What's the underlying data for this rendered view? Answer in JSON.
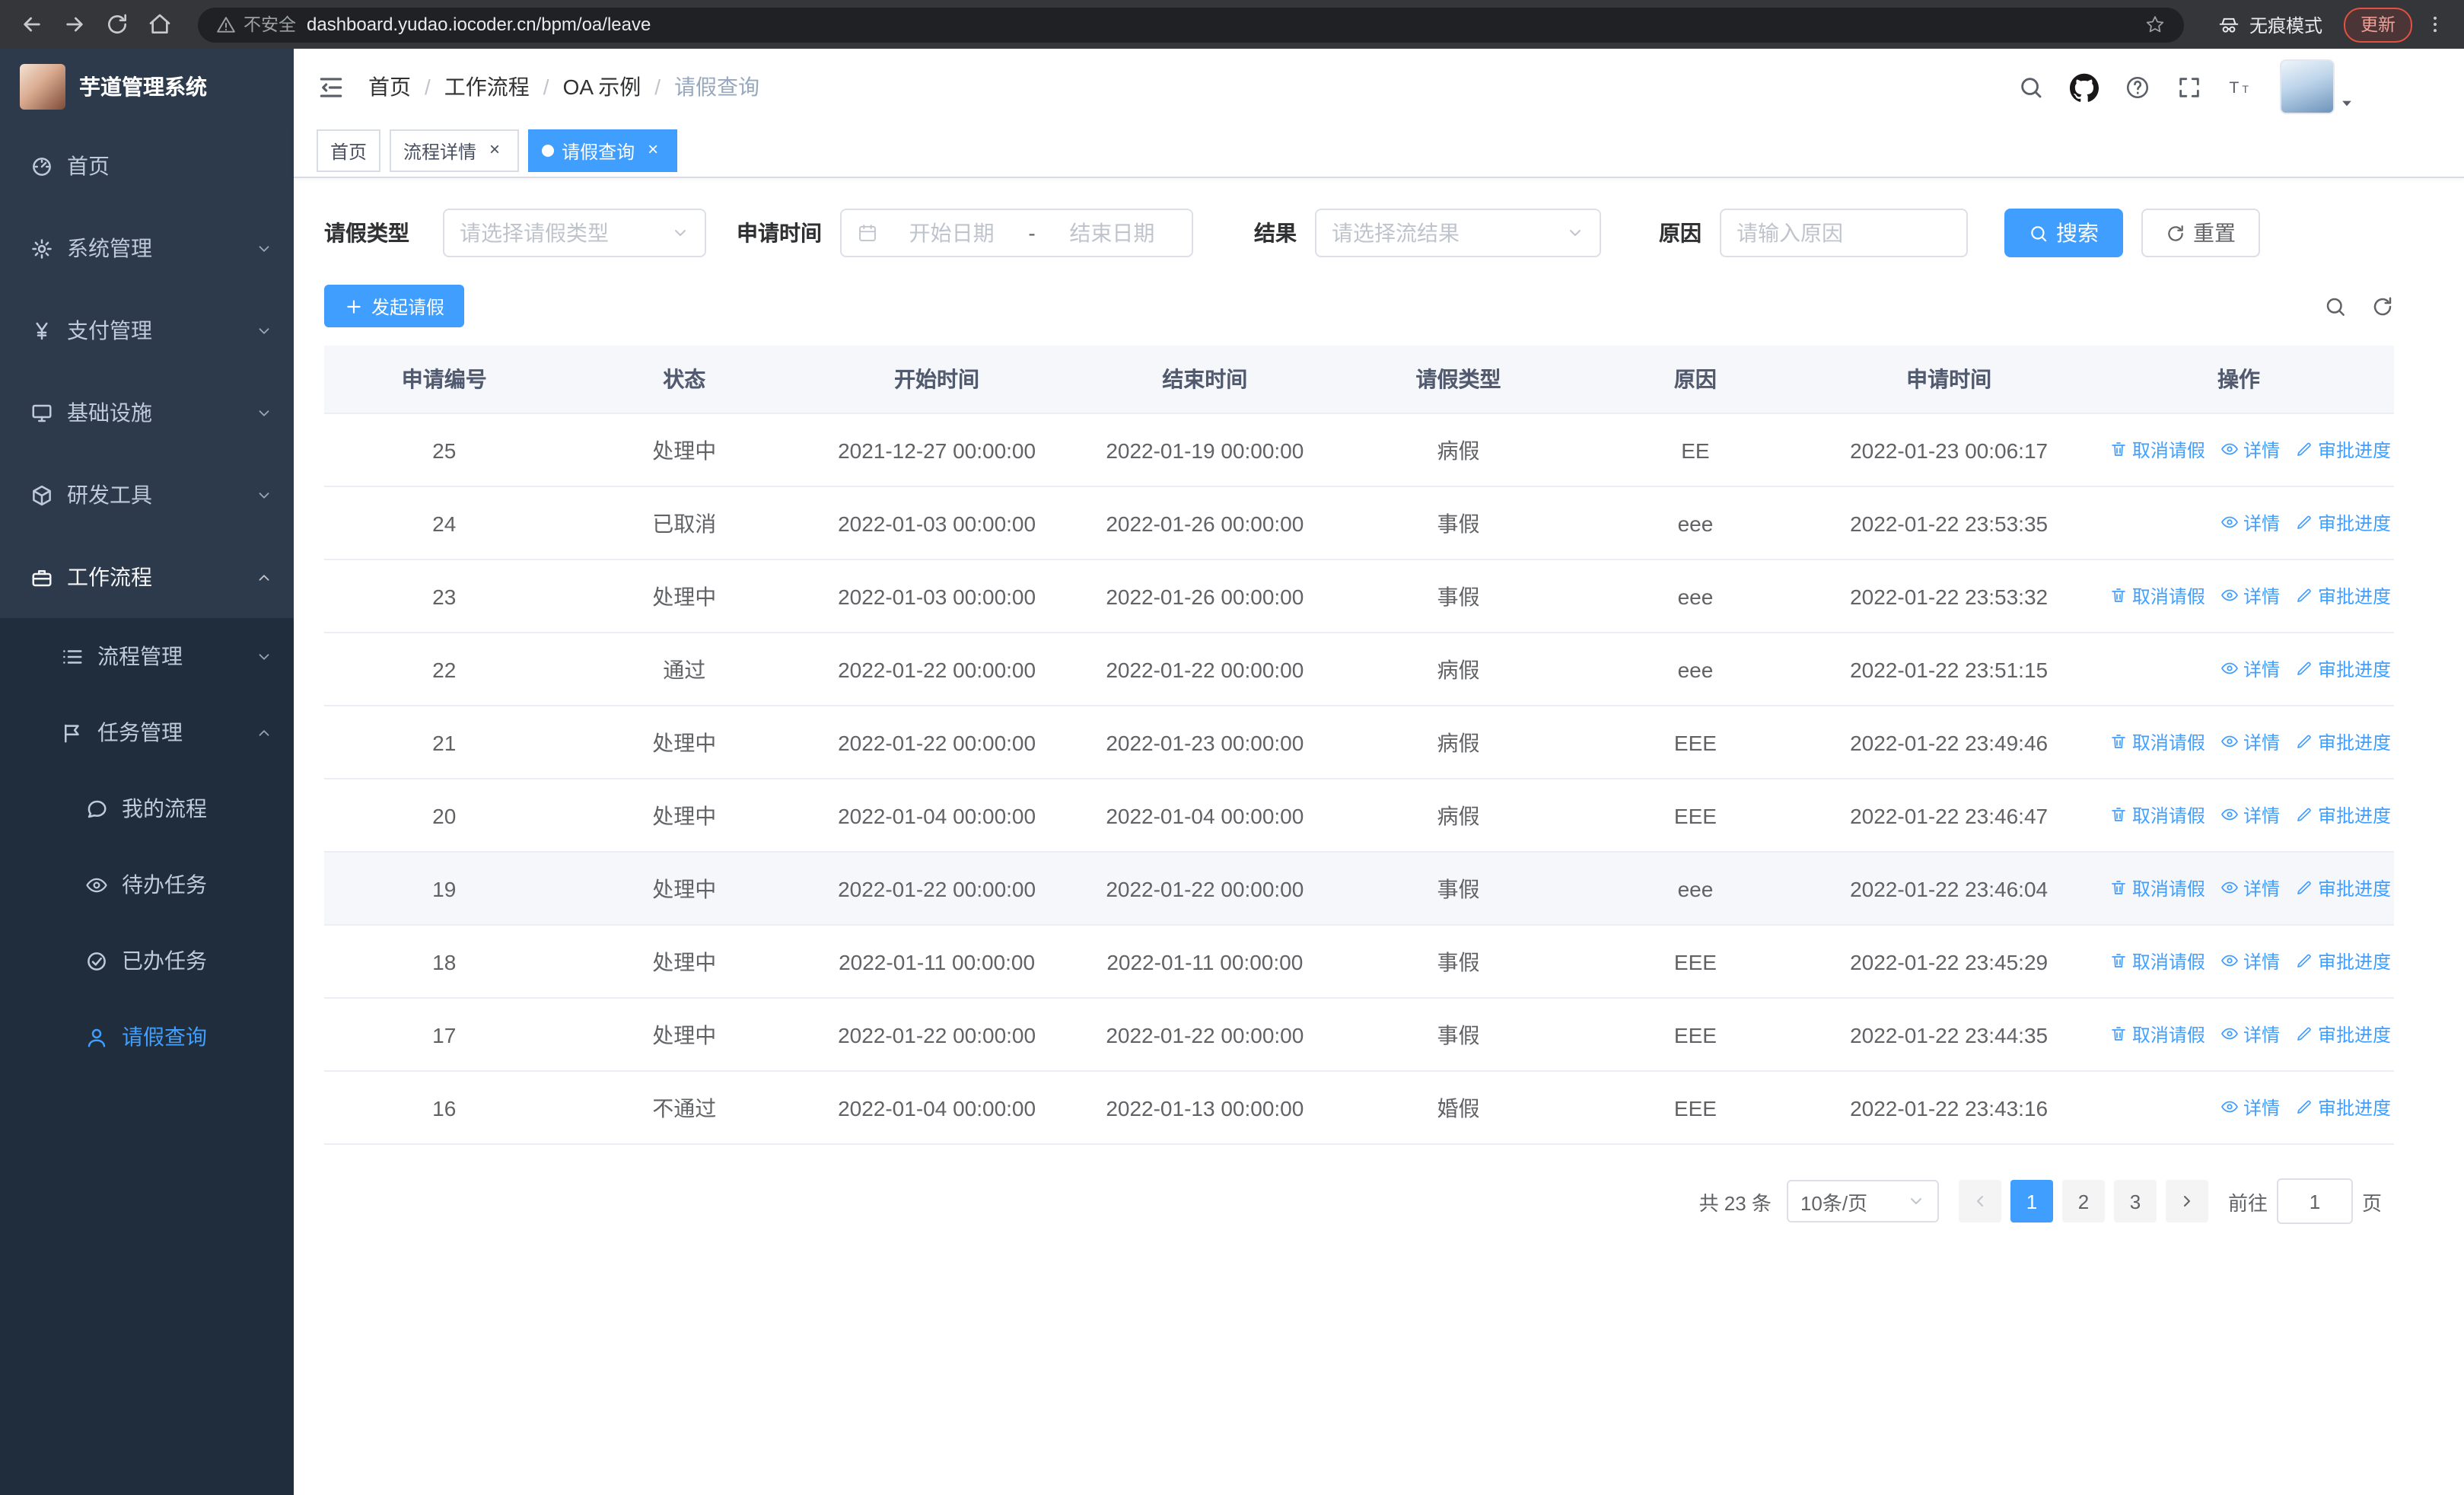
{
  "browser": {
    "security_chip": "不安全",
    "url": "dashboard.yudao.iocoder.cn/bpm/oa/leave",
    "incognito_label": "无痕模式",
    "update_label": "更新"
  },
  "sidebar": {
    "logo_title": "芋道管理系统",
    "items": [
      {
        "name": "home",
        "label": "首页",
        "icon": "dashboard-icon",
        "level": 1
      },
      {
        "name": "system",
        "label": "系统管理",
        "icon": "gear-icon",
        "level": 1,
        "arrow": "down"
      },
      {
        "name": "payment",
        "label": "支付管理",
        "icon": "yen-icon",
        "level": 1,
        "arrow": "down"
      },
      {
        "name": "infrastructure",
        "label": "基础设施",
        "icon": "infra-icon",
        "level": 1,
        "arrow": "down"
      },
      {
        "name": "devtools",
        "label": "研发工具",
        "icon": "tools-icon",
        "level": 1,
        "arrow": "down"
      },
      {
        "name": "workflow",
        "label": "工作流程",
        "icon": "workflow-icon",
        "level": 1,
        "arrow": "up",
        "expanded": true
      },
      {
        "name": "process-management",
        "label": "流程管理",
        "icon": "process-icon",
        "level": 2,
        "arrow": "down"
      },
      {
        "name": "task-management",
        "label": "任务管理",
        "icon": "task-icon",
        "level": 2,
        "arrow": "up",
        "expanded": true
      },
      {
        "name": "my-process",
        "label": "我的流程",
        "icon": "chat-icon",
        "level": 3
      },
      {
        "name": "todo-tasks",
        "label": "待办任务",
        "icon": "eye-icon",
        "level": 3
      },
      {
        "name": "done-tasks",
        "label": "已办任务",
        "icon": "check-circle-icon",
        "level": 3
      },
      {
        "name": "leave-query",
        "label": "请假查询",
        "icon": "user-icon",
        "level": 3,
        "active": true
      }
    ]
  },
  "header": {
    "breadcrumb": [
      "首页",
      "工作流程",
      "OA 示例",
      "请假查询"
    ]
  },
  "tabs": [
    {
      "name": "home",
      "label": "首页",
      "closable": false,
      "active": false
    },
    {
      "name": "process-detail",
      "label": "流程详情",
      "closable": true,
      "active": false
    },
    {
      "name": "leave-query",
      "label": "请假查询",
      "closable": true,
      "active": true
    }
  ],
  "filters": {
    "type_label": "请假类型",
    "type_placeholder": "请选择请假类型",
    "time_label": "申请时间",
    "start_placeholder": "开始日期",
    "range_separator": "-",
    "end_placeholder": "结束日期",
    "result_label": "结果",
    "result_placeholder": "请选择流结果",
    "reason_label": "原因",
    "reason_placeholder": "请输入原因",
    "search_label": "搜索",
    "reset_label": "重置"
  },
  "toolbar": {
    "create_label": "发起请假"
  },
  "table": {
    "columns": [
      "申请编号",
      "状态",
      "开始时间",
      "结束时间",
      "请假类型",
      "原因",
      "申请时间",
      "操作"
    ],
    "actions": {
      "cancel": "取消请假",
      "detail": "详情",
      "progress": "审批进度"
    },
    "rows": [
      {
        "id": "25",
        "status": "处理中",
        "start": "2021-12-27 00:00:00",
        "end": "2022-01-19 00:00:00",
        "type": "病假",
        "reason": "EE",
        "applied": "2022-01-23 00:06:17",
        "cancelable": true
      },
      {
        "id": "24",
        "status": "已取消",
        "start": "2022-01-03 00:00:00",
        "end": "2022-01-26 00:00:00",
        "type": "事假",
        "reason": "eee",
        "applied": "2022-01-22 23:53:35",
        "cancelable": false
      },
      {
        "id": "23",
        "status": "处理中",
        "start": "2022-01-03 00:00:00",
        "end": "2022-01-26 00:00:00",
        "type": "事假",
        "reason": "eee",
        "applied": "2022-01-22 23:53:32",
        "cancelable": true
      },
      {
        "id": "22",
        "status": "通过",
        "start": "2022-01-22 00:00:00",
        "end": "2022-01-22 00:00:00",
        "type": "病假",
        "reason": "eee",
        "applied": "2022-01-22 23:51:15",
        "cancelable": false
      },
      {
        "id": "21",
        "status": "处理中",
        "start": "2022-01-22 00:00:00",
        "end": "2022-01-23 00:00:00",
        "type": "病假",
        "reason": "EEE",
        "applied": "2022-01-22 23:49:46",
        "cancelable": true
      },
      {
        "id": "20",
        "status": "处理中",
        "start": "2022-01-04 00:00:00",
        "end": "2022-01-04 00:00:00",
        "type": "病假",
        "reason": "EEE",
        "applied": "2022-01-22 23:46:47",
        "cancelable": true
      },
      {
        "id": "19",
        "status": "处理中",
        "start": "2022-01-22 00:00:00",
        "end": "2022-01-22 00:00:00",
        "type": "事假",
        "reason": "eee",
        "applied": "2022-01-22 23:46:04",
        "cancelable": true,
        "highlighted": true
      },
      {
        "id": "18",
        "status": "处理中",
        "start": "2022-01-11 00:00:00",
        "end": "2022-01-11 00:00:00",
        "type": "事假",
        "reason": "EEE",
        "applied": "2022-01-22 23:45:29",
        "cancelable": true
      },
      {
        "id": "17",
        "status": "处理中",
        "start": "2022-01-22 00:00:00",
        "end": "2022-01-22 00:00:00",
        "type": "事假",
        "reason": "EEE",
        "applied": "2022-01-22 23:44:35",
        "cancelable": true
      },
      {
        "id": "16",
        "status": "不通过",
        "start": "2022-01-04 00:00:00",
        "end": "2022-01-13 00:00:00",
        "type": "婚假",
        "reason": "EEE",
        "applied": "2022-01-22 23:43:16",
        "cancelable": false
      }
    ]
  },
  "pagination": {
    "total": "共 23 条",
    "page_size": "10条/页",
    "pages": [
      "1",
      "2",
      "3"
    ],
    "active_page": "1",
    "goto_label": "前往",
    "goto_value": "1",
    "page_unit": "页"
  },
  "colors": {
    "primary": "#409eff",
    "sidebar_bg": "#2d3a4b",
    "submenu_bg": "#1f2d3d",
    "browser_bar_bg": "#35363a",
    "table_header_bg": "#f5f7fa",
    "update_red": "#e25142"
  }
}
